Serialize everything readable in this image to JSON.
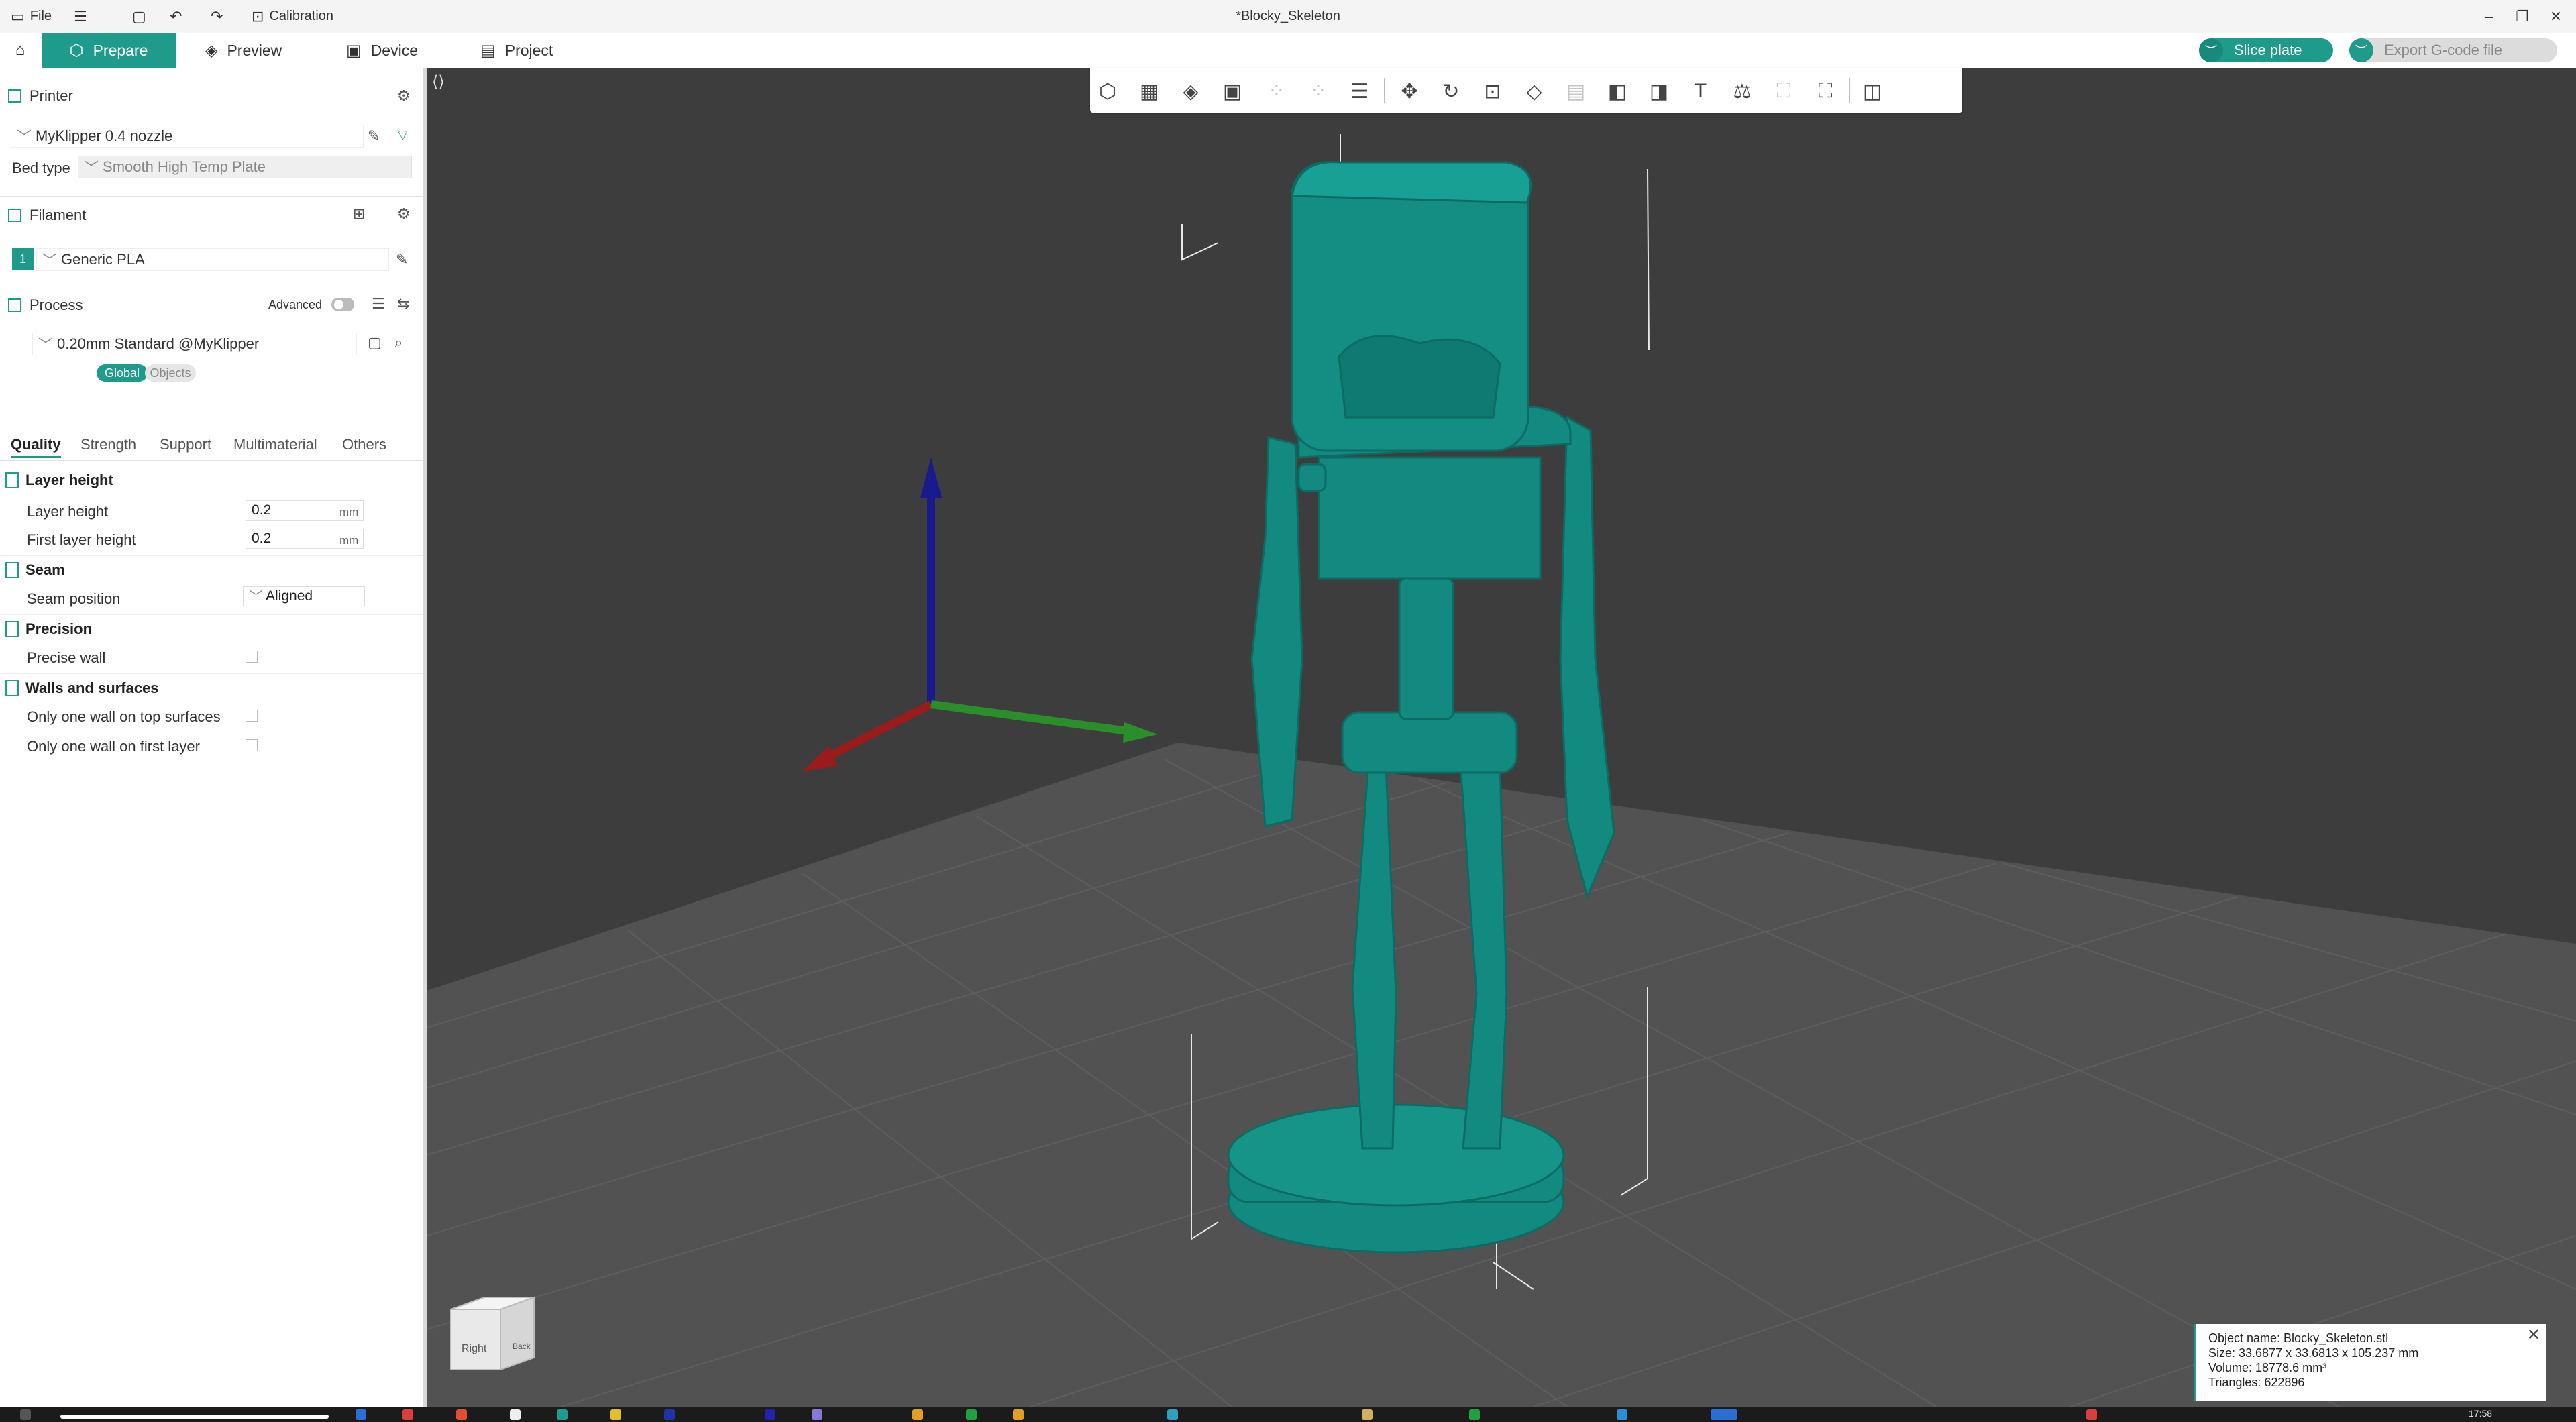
{
  "titlebar": {
    "file_label": "File",
    "calibration_label": "Calibration",
    "window_title": "*Blocky_Skeleton",
    "minimize": "–",
    "restore": "❐",
    "close": "✕"
  },
  "nav": {
    "home_icon": "⌂",
    "tabs": [
      {
        "label": "Prepare",
        "icon": "⬡"
      },
      {
        "label": "Preview",
        "icon": "◈"
      },
      {
        "label": "Device",
        "icon": "▣"
      },
      {
        "label": "Project",
        "icon": "▤"
      }
    ],
    "slice_label": "Slice plate",
    "export_label": "Export G-code file"
  },
  "left": {
    "printer": {
      "title": "Printer",
      "name": "MyKlipper 0.4 nozzle",
      "bed_label": "Bed type",
      "bed_value": "Smooth High Temp Plate"
    },
    "filament": {
      "title": "Filament",
      "slot": "1",
      "name": "Generic PLA"
    },
    "process": {
      "title": "Process",
      "global_label": "Global",
      "objects_label": "Objects",
      "advanced_label": "Advanced",
      "preset": "0.20mm Standard @MyKlipper"
    },
    "tabs": [
      "Quality",
      "Strength",
      "Support",
      "Multimaterial",
      "Others"
    ],
    "groups": {
      "layer_height": {
        "title": "Layer height",
        "layer_height_label": "Layer height",
        "layer_height_value": "0.2",
        "first_layer_label": "First layer height",
        "first_layer_value": "0.2",
        "unit": "mm"
      },
      "seam": {
        "title": "Seam",
        "position_label": "Seam position",
        "position_value": "Aligned"
      },
      "precision": {
        "title": "Precision",
        "precise_wall_label": "Precise wall"
      },
      "walls": {
        "title": "Walls and surfaces",
        "one_wall_top_label": "Only one wall on top surfaces",
        "one_wall_first_label": "Only one wall on first layer"
      }
    }
  },
  "viewport": {
    "cube_right": "Right",
    "cube_back": "Back",
    "model_color": "#138a80",
    "info": {
      "name": "Object name: Blocky_Skeleton.stl",
      "size": "Size: 33.6877 x 33.6813 x 105.237 mm",
      "volume": "Volume: 18778.6 mm³",
      "triangles": "Triangles: 622896"
    }
  },
  "taskbar": {
    "clock": "17:58"
  },
  "colors": {
    "accent": "#1f9b8c",
    "viewport_bg": "#3d3d3d"
  }
}
